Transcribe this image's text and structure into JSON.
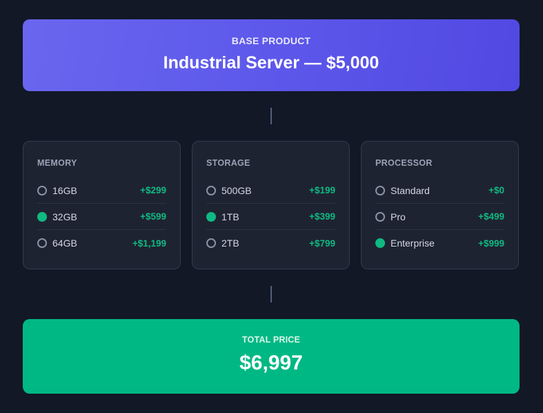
{
  "base": {
    "label": "BASE PRODUCT",
    "title": "Industrial Server — $5,000"
  },
  "options": {
    "memory": {
      "title": "MEMORY",
      "items": [
        {
          "name": "16GB",
          "price": "+$299",
          "selected": false
        },
        {
          "name": "32GB",
          "price": "+$599",
          "selected": true
        },
        {
          "name": "64GB",
          "price": "+$1,199",
          "selected": false
        }
      ]
    },
    "storage": {
      "title": "STORAGE",
      "items": [
        {
          "name": "500GB",
          "price": "+$199",
          "selected": false
        },
        {
          "name": "1TB",
          "price": "+$399",
          "selected": true
        },
        {
          "name": "2TB",
          "price": "+$799",
          "selected": false
        }
      ]
    },
    "processor": {
      "title": "PROCESSOR",
      "items": [
        {
          "name": "Standard",
          "price": "+$0",
          "selected": false
        },
        {
          "name": "Pro",
          "price": "+$499",
          "selected": false
        },
        {
          "name": "Enterprise",
          "price": "+$999",
          "selected": true
        }
      ]
    }
  },
  "total": {
    "label": "TOTAL PRICE",
    "value": "$6,997"
  },
  "colors": {
    "background": "#121826",
    "base_gradient_start": "#6a66ef",
    "base_gradient_end": "#5148e2",
    "accent_green": "#10b981",
    "total_bg": "#00b884",
    "card_bg": "#1e2332"
  }
}
